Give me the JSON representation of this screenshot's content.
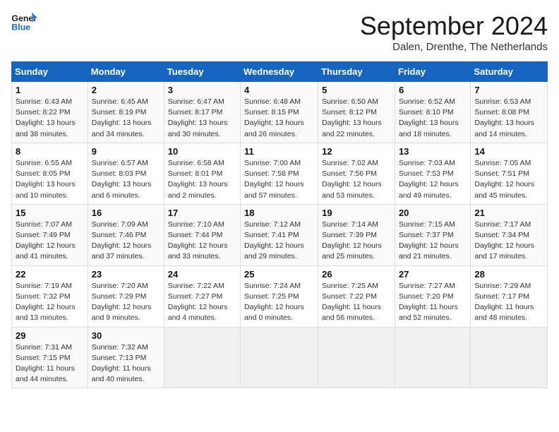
{
  "header": {
    "logo_line1": "General",
    "logo_line2": "Blue",
    "month": "September 2024",
    "location": "Dalen, Drenthe, The Netherlands"
  },
  "weekdays": [
    "Sunday",
    "Monday",
    "Tuesday",
    "Wednesday",
    "Thursday",
    "Friday",
    "Saturday"
  ],
  "weeks": [
    [
      {
        "day": "1",
        "sunrise": "Sunrise: 6:43 AM",
        "sunset": "Sunset: 8:22 PM",
        "daylight": "Daylight: 13 hours and 38 minutes."
      },
      {
        "day": "2",
        "sunrise": "Sunrise: 6:45 AM",
        "sunset": "Sunset: 8:19 PM",
        "daylight": "Daylight: 13 hours and 34 minutes."
      },
      {
        "day": "3",
        "sunrise": "Sunrise: 6:47 AM",
        "sunset": "Sunset: 8:17 PM",
        "daylight": "Daylight: 13 hours and 30 minutes."
      },
      {
        "day": "4",
        "sunrise": "Sunrise: 6:48 AM",
        "sunset": "Sunset: 8:15 PM",
        "daylight": "Daylight: 13 hours and 26 minutes."
      },
      {
        "day": "5",
        "sunrise": "Sunrise: 6:50 AM",
        "sunset": "Sunset: 8:12 PM",
        "daylight": "Daylight: 13 hours and 22 minutes."
      },
      {
        "day": "6",
        "sunrise": "Sunrise: 6:52 AM",
        "sunset": "Sunset: 8:10 PM",
        "daylight": "Daylight: 13 hours and 18 minutes."
      },
      {
        "day": "7",
        "sunrise": "Sunrise: 6:53 AM",
        "sunset": "Sunset: 8:08 PM",
        "daylight": "Daylight: 13 hours and 14 minutes."
      }
    ],
    [
      {
        "day": "8",
        "sunrise": "Sunrise: 6:55 AM",
        "sunset": "Sunset: 8:05 PM",
        "daylight": "Daylight: 13 hours and 10 minutes."
      },
      {
        "day": "9",
        "sunrise": "Sunrise: 6:57 AM",
        "sunset": "Sunset: 8:03 PM",
        "daylight": "Daylight: 13 hours and 6 minutes."
      },
      {
        "day": "10",
        "sunrise": "Sunrise: 6:58 AM",
        "sunset": "Sunset: 8:01 PM",
        "daylight": "Daylight: 13 hours and 2 minutes."
      },
      {
        "day": "11",
        "sunrise": "Sunrise: 7:00 AM",
        "sunset": "Sunset: 7:58 PM",
        "daylight": "Daylight: 12 hours and 57 minutes."
      },
      {
        "day": "12",
        "sunrise": "Sunrise: 7:02 AM",
        "sunset": "Sunset: 7:56 PM",
        "daylight": "Daylight: 12 hours and 53 minutes."
      },
      {
        "day": "13",
        "sunrise": "Sunrise: 7:03 AM",
        "sunset": "Sunset: 7:53 PM",
        "daylight": "Daylight: 12 hours and 49 minutes."
      },
      {
        "day": "14",
        "sunrise": "Sunrise: 7:05 AM",
        "sunset": "Sunset: 7:51 PM",
        "daylight": "Daylight: 12 hours and 45 minutes."
      }
    ],
    [
      {
        "day": "15",
        "sunrise": "Sunrise: 7:07 AM",
        "sunset": "Sunset: 7:49 PM",
        "daylight": "Daylight: 12 hours and 41 minutes."
      },
      {
        "day": "16",
        "sunrise": "Sunrise: 7:09 AM",
        "sunset": "Sunset: 7:46 PM",
        "daylight": "Daylight: 12 hours and 37 minutes."
      },
      {
        "day": "17",
        "sunrise": "Sunrise: 7:10 AM",
        "sunset": "Sunset: 7:44 PM",
        "daylight": "Daylight: 12 hours and 33 minutes."
      },
      {
        "day": "18",
        "sunrise": "Sunrise: 7:12 AM",
        "sunset": "Sunset: 7:41 PM",
        "daylight": "Daylight: 12 hours and 29 minutes."
      },
      {
        "day": "19",
        "sunrise": "Sunrise: 7:14 AM",
        "sunset": "Sunset: 7:39 PM",
        "daylight": "Daylight: 12 hours and 25 minutes."
      },
      {
        "day": "20",
        "sunrise": "Sunrise: 7:15 AM",
        "sunset": "Sunset: 7:37 PM",
        "daylight": "Daylight: 12 hours and 21 minutes."
      },
      {
        "day": "21",
        "sunrise": "Sunrise: 7:17 AM",
        "sunset": "Sunset: 7:34 PM",
        "daylight": "Daylight: 12 hours and 17 minutes."
      }
    ],
    [
      {
        "day": "22",
        "sunrise": "Sunrise: 7:19 AM",
        "sunset": "Sunset: 7:32 PM",
        "daylight": "Daylight: 12 hours and 13 minutes."
      },
      {
        "day": "23",
        "sunrise": "Sunrise: 7:20 AM",
        "sunset": "Sunset: 7:29 PM",
        "daylight": "Daylight: 12 hours and 9 minutes."
      },
      {
        "day": "24",
        "sunrise": "Sunrise: 7:22 AM",
        "sunset": "Sunset: 7:27 PM",
        "daylight": "Daylight: 12 hours and 4 minutes."
      },
      {
        "day": "25",
        "sunrise": "Sunrise: 7:24 AM",
        "sunset": "Sunset: 7:25 PM",
        "daylight": "Daylight: 12 hours and 0 minutes."
      },
      {
        "day": "26",
        "sunrise": "Sunrise: 7:25 AM",
        "sunset": "Sunset: 7:22 PM",
        "daylight": "Daylight: 11 hours and 56 minutes."
      },
      {
        "day": "27",
        "sunrise": "Sunrise: 7:27 AM",
        "sunset": "Sunset: 7:20 PM",
        "daylight": "Daylight: 11 hours and 52 minutes."
      },
      {
        "day": "28",
        "sunrise": "Sunrise: 7:29 AM",
        "sunset": "Sunset: 7:17 PM",
        "daylight": "Daylight: 11 hours and 48 minutes."
      }
    ],
    [
      {
        "day": "29",
        "sunrise": "Sunrise: 7:31 AM",
        "sunset": "Sunset: 7:15 PM",
        "daylight": "Daylight: 11 hours and 44 minutes."
      },
      {
        "day": "30",
        "sunrise": "Sunrise: 7:32 AM",
        "sunset": "Sunset: 7:13 PM",
        "daylight": "Daylight: 11 hours and 40 minutes."
      },
      null,
      null,
      null,
      null,
      null
    ]
  ]
}
